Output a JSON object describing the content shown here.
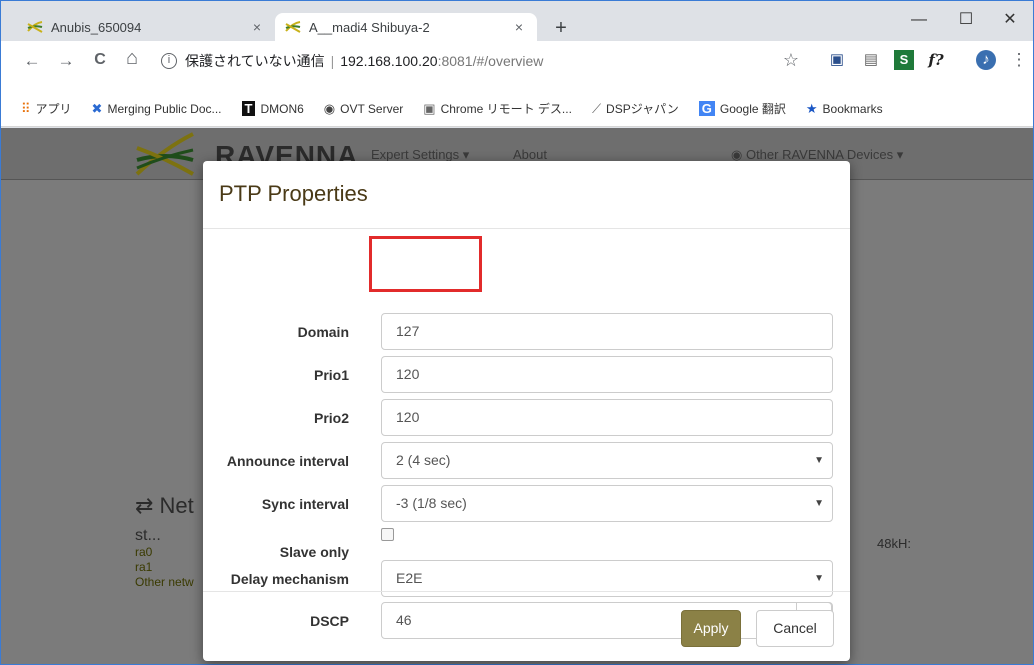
{
  "browser": {
    "tabs": [
      {
        "title": "Anubis_650094",
        "close": "×"
      },
      {
        "title": "A__madi4 Shibuya-2",
        "close": "×"
      }
    ],
    "new_tab": "+",
    "window_controls": {
      "minimize": "—",
      "maximize": "☐",
      "close": "✕"
    },
    "nav": {
      "back": "←",
      "forward": "→",
      "reload": "C",
      "home": "⌂"
    },
    "address": {
      "security_label": "保護されていない通信",
      "separator": "|",
      "host": "192.168.100.20",
      "path": ":8081/#/overview"
    },
    "extensions": {
      "star": "☆",
      "ext1": "▣",
      "ext2": "▤",
      "ext3": "S",
      "ext4": "f?",
      "profile": "♪",
      "menu": "⋮"
    },
    "bookmarks": [
      {
        "icon": "apps-icon",
        "label": "アプリ"
      },
      {
        "icon": "confluence-icon",
        "label": "Merging Public Doc..."
      },
      {
        "icon": "t-icon",
        "label": "DMON6"
      },
      {
        "icon": "globe-icon",
        "label": "OVT Server"
      },
      {
        "icon": "remote-desktop-icon",
        "label": "Chrome リモート デス..."
      },
      {
        "icon": "dsp-icon",
        "label": "DSPジャパン"
      },
      {
        "icon": "translate-icon",
        "label": "Google 翻訳"
      },
      {
        "icon": "star-icon",
        "label": "Bookmarks"
      }
    ],
    "bookmark_glyphs": [
      "⠿",
      "✖",
      "T",
      "◉",
      "▣",
      "⟋",
      "G",
      "★"
    ]
  },
  "background_page": {
    "brand": "RAVENNA",
    "nav": {
      "expert_settings": "Expert Settings ▾",
      "about": "About",
      "other_devices": "◉ Other RAVENNA Devices ▾"
    },
    "network_header": "⇄ Net",
    "network_status": "st...",
    "network_items": [
      "ra0",
      "ra1",
      "Other netw"
    ],
    "rate": "48kH:"
  },
  "modal": {
    "title": "PTP Properties",
    "fields": {
      "domain": {
        "label": "Domain",
        "value": "127"
      },
      "prio1": {
        "label": "Prio1",
        "value": "120"
      },
      "prio2": {
        "label": "Prio2",
        "value": "120"
      },
      "announce_interval": {
        "label": "Announce interval",
        "value": "2 (4 sec)"
      },
      "sync_interval": {
        "label": "Sync interval",
        "value": "-3 (1/8 sec)"
      },
      "slave_only": {
        "label": "Slave only",
        "checked": false
      },
      "delay_mechanism": {
        "label": "Delay mechanism",
        "value": "E2E"
      },
      "dscp": {
        "label": "DSCP",
        "value": "46"
      }
    },
    "caret": "▼",
    "apply_label": "Apply",
    "cancel_label": "Cancel"
  },
  "colors": {
    "apply_button": "#8b8146",
    "highlight_box": "#e22b2b",
    "modal_title": "#4a3a17"
  }
}
